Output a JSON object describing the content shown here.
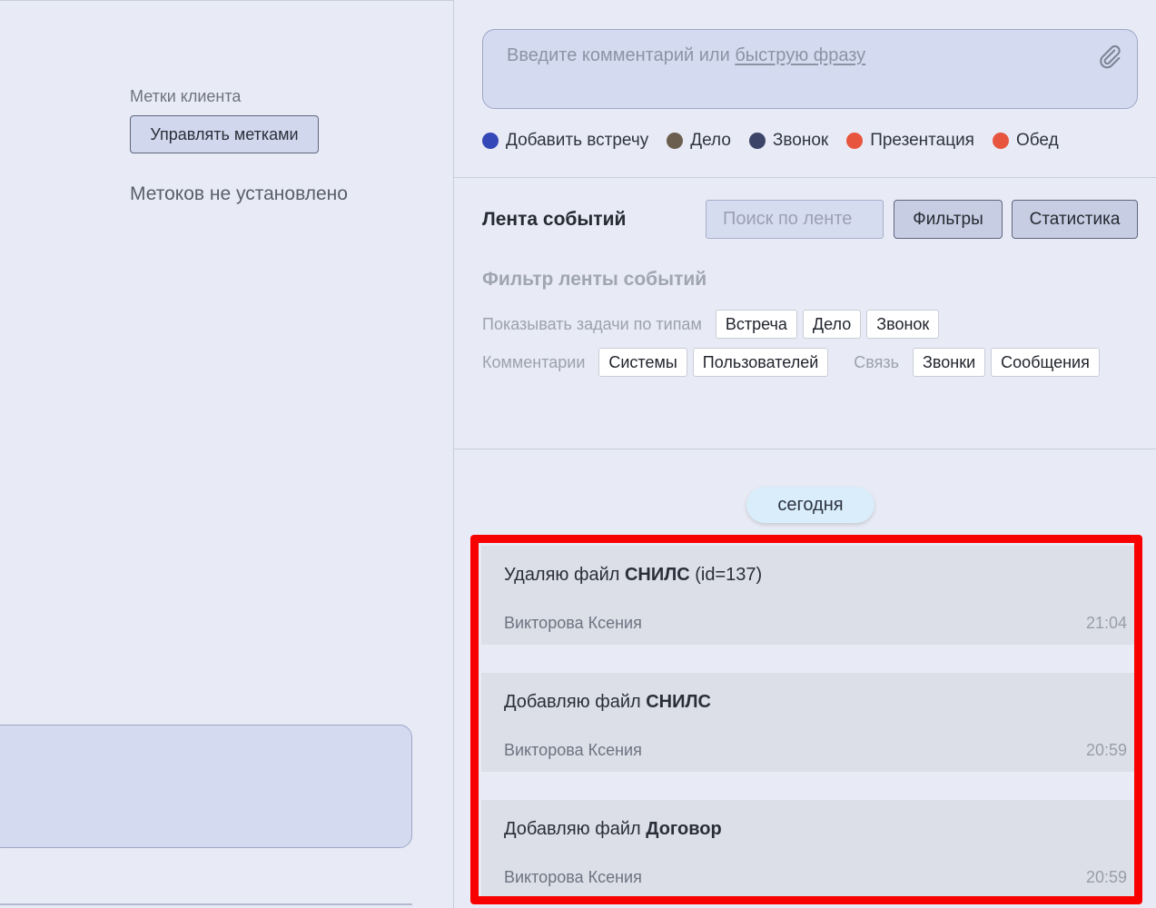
{
  "left_panel": {
    "tags_label": "Метки клиента",
    "manage_tags_button": "Управлять метками",
    "no_tags_text": "Метоков не установлено"
  },
  "comment": {
    "placeholder_prefix": "Введите комментарий или",
    "quick_phrase_link": "быструю фразу",
    "attach_icon": "paperclip-icon"
  },
  "event_types": [
    {
      "label": "Добавить встречу",
      "color": "#3548b8"
    },
    {
      "label": "Дело",
      "color": "#6b5e4e"
    },
    {
      "label": "Звонок",
      "color": "#3c4468"
    },
    {
      "label": "Презентация",
      "color": "#e8553f"
    },
    {
      "label": "Обед",
      "color": "#e8553f"
    }
  ],
  "feed": {
    "title": "Лента событий",
    "search_placeholder": "Поиск по ленте",
    "filters_button": "Фильтры",
    "stats_button": "Статистика"
  },
  "filter": {
    "heading": "Фильтр ленты событий",
    "row1_label": "Показывать задачи по типам",
    "row1_chips": [
      "Встреча",
      "Дело",
      "Звонок"
    ],
    "row2_label": "Комментарии",
    "row2_chips": [
      "Системы",
      "Пользователей"
    ],
    "row2_label2": "Связь",
    "row2_chips2": [
      "Звонки",
      "Сообщения"
    ]
  },
  "date_separator": "сегодня",
  "events": [
    {
      "prefix": "Удаляю файл ",
      "bold": "СНИЛС",
      "suffix": " (id=137)",
      "author": "Викторова Ксения",
      "time": "21:04"
    },
    {
      "prefix": "Добавляю файл ",
      "bold": "СНИЛС",
      "suffix": "",
      "author": "Викторова Ксения",
      "time": "20:59"
    },
    {
      "prefix": "Добавляю файл ",
      "bold": "Договор",
      "suffix": "",
      "author": "Викторова Ксения",
      "time": "20:59"
    }
  ],
  "highlight_color": "#f80000"
}
